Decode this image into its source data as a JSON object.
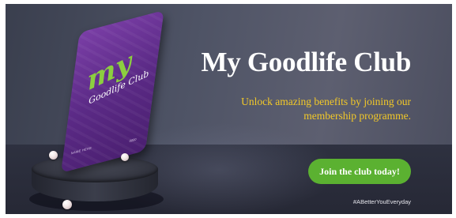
{
  "banner": {
    "title": "My Goodlife Club",
    "subtitle": "Unlock amazing benefits by joining our membership programme.",
    "cta_label": "Join the club today!",
    "hashtag": "#ABetterYouEveryday",
    "colors": {
      "title": "#ffffff",
      "subtitle": "#f3c928",
      "cta_background": "#5bb131",
      "card": "#5b2a86",
      "logo_accent": "#8ccf3f"
    }
  },
  "card": {
    "logo_my": "my",
    "logo_text": "Goodlife Club",
    "name_field": "NAME HERE",
    "number_field": "0000"
  }
}
